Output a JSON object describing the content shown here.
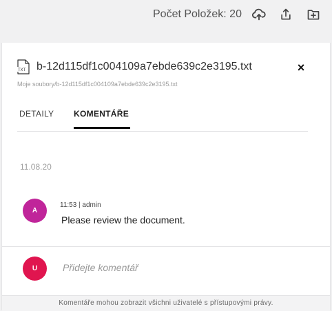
{
  "toolbar": {
    "item_count_label": "Počet Položek: 20",
    "icons": [
      "cloud-upload-icon",
      "share-upload-icon",
      "new-folder-icon"
    ]
  },
  "file": {
    "icon_label": "TXT",
    "name": "b-12d115df1c004109a7ebde639c2e3195.txt",
    "path": "Moje soubory/b-12d115df1c004109a7ebde639c2e3195.txt",
    "close_glyph": "×"
  },
  "tabs": [
    {
      "label": "DETAILY",
      "active": false
    },
    {
      "label": "KOMENTÁŘE",
      "active": true
    }
  ],
  "comments": {
    "date": "11.08.20",
    "items": [
      {
        "avatar_initial": "A",
        "avatar_color": "#c0259a",
        "time": "11:53",
        "author": "admin",
        "meta": "11:53 | admin",
        "text": "Please review the document."
      }
    ]
  },
  "composer": {
    "avatar_initial": "U",
    "avatar_color": "#e0154f",
    "placeholder": "Přidejte komentář"
  },
  "footer": {
    "note": "Komentáře mohou zobrazit všichni uživatelé s přístupovými právy."
  }
}
